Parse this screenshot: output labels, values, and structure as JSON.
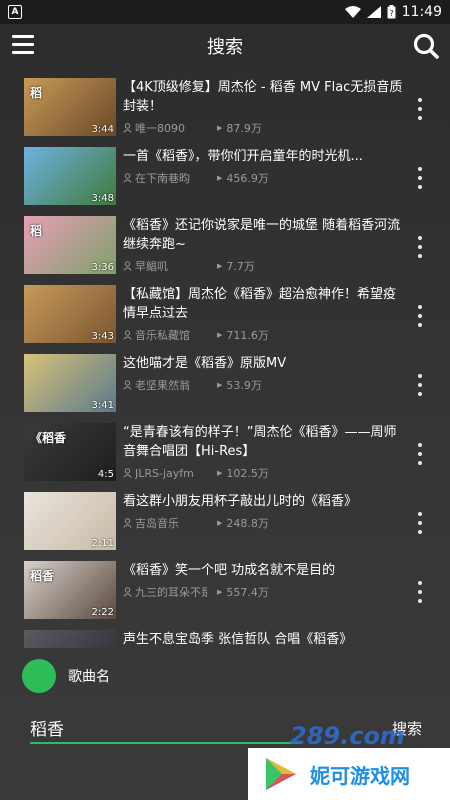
{
  "status": {
    "badge": "A",
    "time": "11:49",
    "battery": "?"
  },
  "appbar": {
    "title": "搜索"
  },
  "videos": [
    {
      "title": "【4K顶级修复】周杰伦 - 稻香 MV Flac无损音质封装！",
      "author": "唯一8090",
      "plays": "87.9万",
      "duration": "3:44",
      "thumb_text": "稻",
      "thumb_colors": [
        "#c79a55",
        "#6b4a2a"
      ]
    },
    {
      "title": "一首《稻香》，带你们开启童年的时光机...",
      "author": "在下南巷昀",
      "plays": "456.9万",
      "duration": "3:48",
      "thumb_text": "",
      "thumb_colors": [
        "#6fb2e0",
        "#3f7a3a"
      ]
    },
    {
      "title": "《稻香》还记你说家是唯一的城堡 随着稻香河流继续奔跑~",
      "author": "早鲳叽",
      "plays": "7.7万",
      "duration": "3:36",
      "thumb_text": "稻",
      "thumb_colors": [
        "#e8a0b8",
        "#7fa06a"
      ]
    },
    {
      "title": "【私藏馆】周杰伦《稻香》超治愈神作！希望疫情早点过去",
      "author": "音乐私藏馆",
      "plays": "711.6万",
      "duration": "3:43",
      "thumb_text": "",
      "thumb_colors": [
        "#c89a5a",
        "#7a5530"
      ]
    },
    {
      "title": "这他喵才是《稻香》原版MV",
      "author": "老坚果然翁",
      "plays": "53.9万",
      "duration": "3:41",
      "thumb_text": "",
      "thumb_colors": [
        "#d9c27a",
        "#5b7a8c"
      ]
    },
    {
      "title": "“是青春该有的样子！”周杰伦《稻香》——周师音舞合唱团【Hi-Res】",
      "author": "JLRS-jayfm",
      "plays": "102.5万",
      "duration": "4:5",
      "thumb_text": "《稻香",
      "thumb_colors": [
        "#3a3a3a",
        "#1e1e1e"
      ]
    },
    {
      "title": "看这群小朋友用杯子敲出儿时的《稻香》",
      "author": "吉岛音乐",
      "plays": "248.8万",
      "duration": "2:11",
      "thumb_text": "",
      "thumb_colors": [
        "#e8e4dc",
        "#c9b9a6"
      ]
    },
    {
      "title": "《稻香》笑一个吧 功成名就不是目的",
      "author": "九三的耳朵不是特别好",
      "plays": "557.4万",
      "duration": "2:22",
      "thumb_text": "稻香",
      "thumb_colors": [
        "#d8d0c8",
        "#5a4a40"
      ]
    },
    {
      "title": "声生不息宝岛季 张信哲队 合唱《稻香》",
      "author": "",
      "plays": "",
      "duration": "",
      "thumb_text": "",
      "thumb_colors": [
        "#5a5a60",
        "#2a2a30"
      ]
    }
  ],
  "player": {
    "song_name": "歌曲名",
    "dot_color": "#2ebd59"
  },
  "search": {
    "query": "稻香",
    "placeholder": "",
    "submit_label": "搜索"
  },
  "watermark": {
    "site": "289.com",
    "brand": "妮可游戏网"
  },
  "colors": {
    "accent": "#2ebd59",
    "meta_text": "#9a9a9a"
  }
}
